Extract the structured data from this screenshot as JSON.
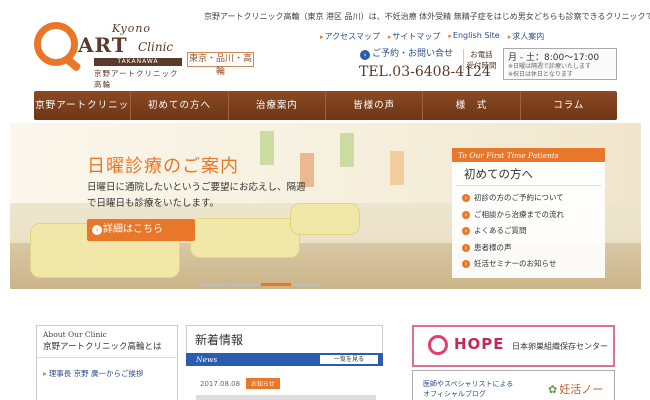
{
  "header": {
    "logo": {
      "kyono": "Kyono",
      "art": "ART",
      "clinic": "Clinic",
      "takanawa": "TAKANAWA",
      "jp": "京野アートクリニック高輪"
    },
    "badge": "東京・品川・高輪",
    "tagline": "京野アートクリニック高輪（東京 港区 品川）は、不妊治療 体外受精 無精子症をはじめ男女どちらも診察できるクリニックです。",
    "toplinks": [
      "アクセスマップ",
      "サイトマップ",
      "English Site",
      "求人案内"
    ],
    "contact": "ご予約・お問い合せ",
    "phone_label": "お電話 受付時間",
    "phone": "TEL.03-6408-4124",
    "hours": {
      "time": "月 - 土：8:00～17:00",
      "note1": "※日曜は隔週で診療いたします",
      "note2": "※祝日は休日となります"
    }
  },
  "nav": [
    "京野アートクリニック高輪とは",
    "初めての方へ",
    "治療案内",
    "皆様の声",
    "様　式",
    "コラム"
  ],
  "hero": {
    "title": "日曜診療のご案内",
    "desc": "日曜日に通院したいというご要望にお応えし、隔週で日曜日も診療をいたします。",
    "button": "詳細はこちら"
  },
  "first_time": {
    "label": "To Our First Time Patients",
    "title": "初めての方へ",
    "items": [
      "初診の方のご予約について",
      "ご相談から治療までの流れ",
      "よくあるご質問",
      "患者様の声",
      "妊活セミナーのお知らせ"
    ]
  },
  "about": {
    "en": "About Our Clinic",
    "ja": "京野アートクリニック高輪とは",
    "link": "理事長 京野 廣一からご挨拶"
  },
  "news": {
    "title": "新着情報",
    "bar": "News",
    "list_button": "一覧を見る",
    "date": "2017.08.08",
    "tag": "お知らせ"
  },
  "hope": {
    "name": "HOPE",
    "sub": "日本卵巣組織保存センター"
  },
  "blog": {
    "line1": "医師やスペシャリストによる",
    "line2": "オフィシャルブログ",
    "name": "妊活ノート"
  },
  "colors": {
    "accent": "#e8772a",
    "nav": "#7a3f1c",
    "link": "#2a4d88"
  }
}
